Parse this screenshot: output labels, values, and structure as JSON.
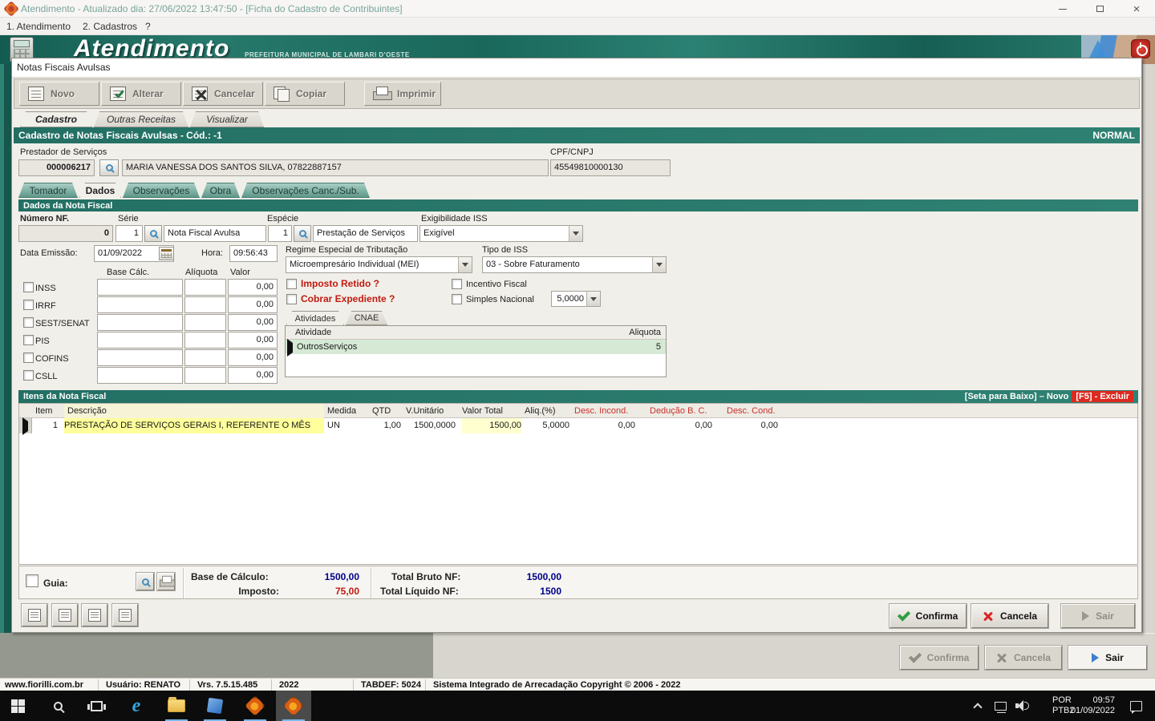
{
  "titlebar": {
    "title": "Atendimento - Atualizado dia: 27/06/2022 13:47:50 - [Ficha do Cadastro de Contribuintes]",
    "close_glyph": "×"
  },
  "menubar": {
    "items": [
      "1. Atendimento",
      "2. Cadastros",
      "?"
    ]
  },
  "banner": {
    "logo": "Atendimento",
    "subtitle": "PREFEITURA MUNICIPAL DE LAMBARI D'OESTE"
  },
  "win": {
    "title": "Notas Fiscais Avulsas",
    "toolbar": [
      {
        "label": "Novo"
      },
      {
        "label": "Alterar"
      },
      {
        "label": "Cancelar"
      },
      {
        "label": "Copiar"
      },
      {
        "label": "Imprimir"
      }
    ],
    "tabs_main": [
      {
        "label": "Cadastro"
      },
      {
        "label": "Outras Receitas"
      },
      {
        "label": "Visualizar"
      }
    ],
    "header": {
      "title": "Cadastro de Notas Fiscais Avulsas - Cód.: -1",
      "status": "NORMAL"
    },
    "prestador": {
      "label": "Prestador de Serviços",
      "code": "000006217",
      "name": "MARIA VANESSA DOS SANTOS SILVA, 07822887157",
      "cpf_label": "CPF/CNPJ",
      "cpf": "45549810000130"
    },
    "tabs_detail": [
      {
        "label": "Tomador"
      },
      {
        "label": "Dados"
      },
      {
        "label": "Observações"
      },
      {
        "label": "Obra"
      },
      {
        "label": "Observações Canc./Sub."
      }
    ],
    "dados": {
      "section_title": "Dados da Nota Fiscal",
      "numero_label": "Número NF.",
      "numero": "0",
      "serie_label": "Série",
      "serie": "1",
      "serie_desc": "Nota Fiscal Avulsa",
      "especie_label": "Espécie",
      "especie": "1",
      "especie_desc": "Prestação de Serviços",
      "exig_label": "Exigibilidade ISS",
      "exig": "Exigível",
      "data_label": "Data Emissão:",
      "data": "01/09/2022",
      "hora_label": "Hora:",
      "hora": "09:56:43",
      "regime_label": "Regime Especial de Tributação",
      "regime": "Microempresário Individual (MEI)",
      "tipo_label": "Tipo de ISS",
      "tipo": "03 - Sobre Faturamento",
      "col_base": "Base Cálc.",
      "col_aliq": "Alíquota",
      "col_valor": "Valor",
      "taxes": [
        {
          "label": "INSS",
          "valor": "0,00"
        },
        {
          "label": "IRRF",
          "valor": "0,00"
        },
        {
          "label": "SEST/SENAT",
          "valor": "0,00"
        },
        {
          "label": "PIS",
          "valor": "0,00"
        },
        {
          "label": "COFINS",
          "valor": "0,00"
        },
        {
          "label": "CSLL",
          "valor": "0,00"
        }
      ],
      "imposto_retido": "Imposto Retido ?",
      "cobrar_expediente": "Cobrar Expediente ?",
      "incentivo": "Incentivo Fiscal",
      "simples": "Simples Nacional",
      "simples_valor": "5,0000",
      "ativ_tabs": [
        {
          "label": "Atividades"
        },
        {
          "label": "CNAE"
        }
      ],
      "ativ_col1": "Atividade",
      "ativ_col2": "Aliquota",
      "ativ_row": {
        "nome": "OutrosServiços",
        "aliquota": "5"
      }
    },
    "itens": {
      "section_title": "Itens da Nota Fiscal",
      "hint_novo": "[Seta para Baixo] – Novo",
      "hint_excluir": "[F5] - Excluir",
      "columns": [
        "Item",
        "Descrição",
        "Medida",
        "QTD",
        "V.Unitário",
        "Valor Total",
        "Aliq.(%)",
        "Desc. Incond.",
        "Dedução B. C.",
        "Desc. Cond."
      ],
      "row": {
        "item": "1",
        "descricao": "PRESTAÇÃO DE SERVIÇOS GERAIS I, REFERENTE O MÊS",
        "medida": "UN",
        "qtd": "1,00",
        "v_unitario": "1500,0000",
        "valor_total": "1500,00",
        "aliq": "5,0000",
        "desc_incond": "0,00",
        "deducao": "0,00",
        "desc_cond": "0,00"
      }
    },
    "totals": {
      "guia_label": "Guia:",
      "base_label": "Base de Cálculo:",
      "base": "1500,00",
      "imposto_label": "Imposto:",
      "imposto": "75,00",
      "bruto_label": "Total Bruto NF:",
      "bruto": "1500,00",
      "liquido_label": "Total Líquido NF:",
      "liquido": "1500"
    },
    "buttons": {
      "confirma": "Confirma",
      "cancela": "Cancela",
      "sair": "Sair"
    }
  },
  "outer_buttons": {
    "confirma": "Confirma",
    "cancela": "Cancela",
    "sair": "Sair"
  },
  "statusbar": {
    "site": "www.fiorilli.com.br",
    "user": "Usuário: RENATO",
    "version": "Vrs. 7.5.15.485",
    "year": "2022",
    "tabdef": "TABDEF: 5024",
    "copyright": "Sistema Integrado de Arrecadação Copyright © 2006 - 2022"
  },
  "taskbar": {
    "ie_letter": "e",
    "lang_top": "POR",
    "lang_bottom": "PTB2",
    "time": "09:57",
    "date": "01/09/2022"
  },
  "colors": {
    "teal": "#2a7d6f",
    "red": "#c21a10",
    "navy": "#00008b",
    "highlight": "#ffff9c",
    "excluir_bg": "#dd2a20"
  }
}
